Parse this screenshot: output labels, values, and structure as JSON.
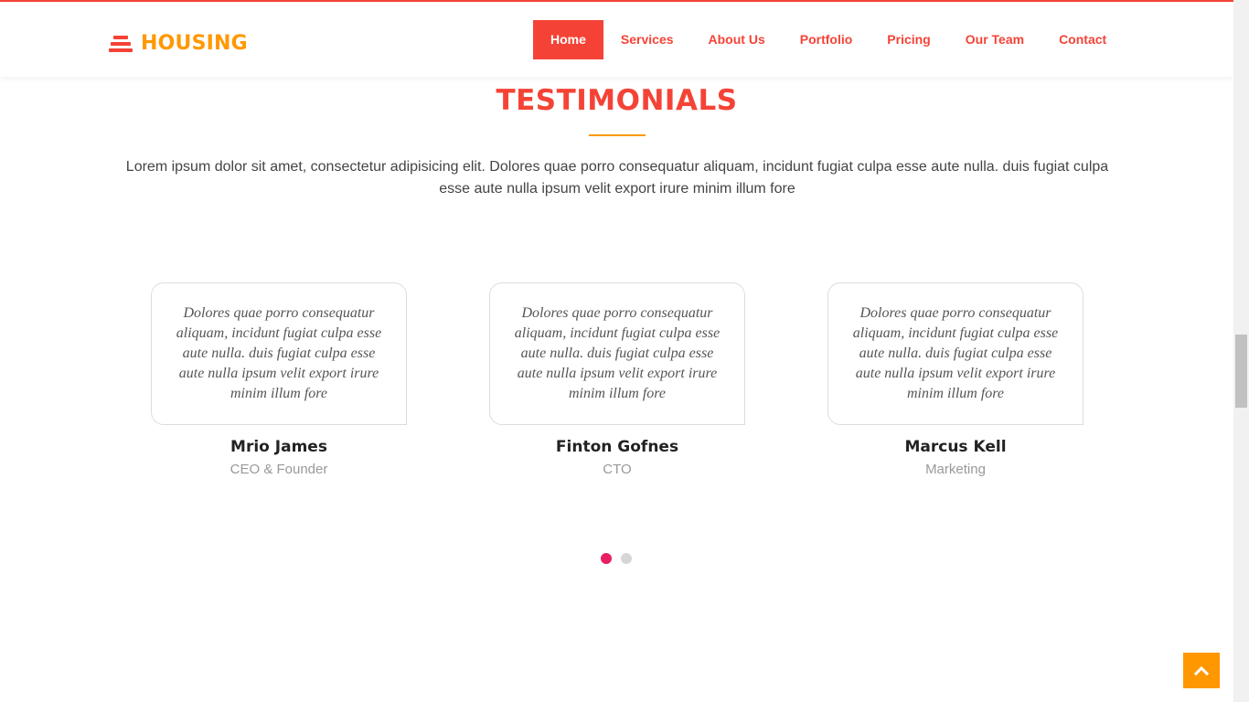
{
  "header": {
    "brand": "HOUSING",
    "nav": [
      {
        "label": "Home",
        "active": true
      },
      {
        "label": "Services"
      },
      {
        "label": "About Us"
      },
      {
        "label": "Portfolio"
      },
      {
        "label": "Pricing"
      },
      {
        "label": "Our Team"
      },
      {
        "label": "Contact"
      }
    ]
  },
  "section": {
    "title": "TESTIMONIALS",
    "intro": "Lorem ipsum dolor sit amet, consectetur adipisicing elit. Dolores quae porro consequatur aliquam, incidunt fugiat culpa esse aute nulla. duis fugiat culpa esse aute nulla ipsum velit export irure minim illum fore"
  },
  "testimonials": [
    {
      "quote": "Dolores quae porro consequatur aliquam, incidunt fugiat culpa esse aute nulla. duis fugiat culpa esse aute nulla ipsum velit export irure minim illum fore",
      "name": "Mrio James",
      "role": "CEO & Founder"
    },
    {
      "quote": "Dolores quae porro consequatur aliquam, incidunt fugiat culpa esse aute nulla. duis fugiat culpa esse aute nulla ipsum velit export irure minim illum fore",
      "name": "Finton Gofnes",
      "role": "CTO"
    },
    {
      "quote": "Dolores quae porro consequatur aliquam, incidunt fugiat culpa esse aute nulla. duis fugiat culpa esse aute nulla ipsum velit export irure minim illum fore",
      "name": "Marcus Kell",
      "role": "Marketing"
    }
  ],
  "carousel": {
    "pages": 2,
    "active_page": 1
  },
  "icons": {
    "logo": "stacked-bars-icon",
    "back_to_top": "chevron-up-icon"
  },
  "colors": {
    "primary": "#f44336",
    "accent": "#ff9800",
    "dot_active": "#e91e63"
  }
}
